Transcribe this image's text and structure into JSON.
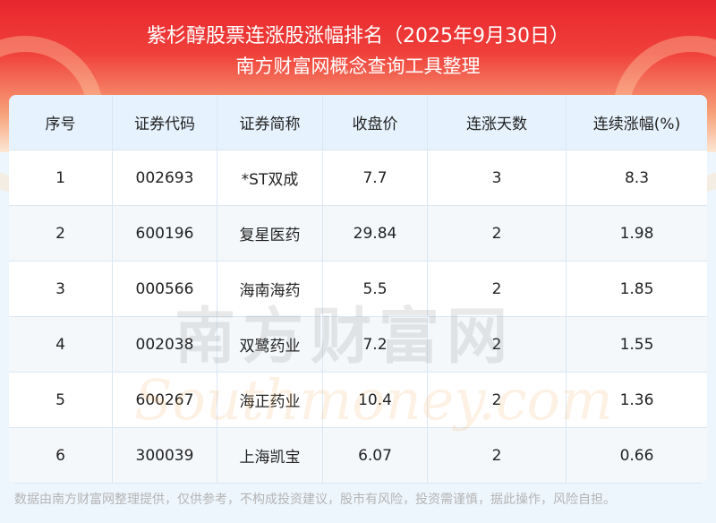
{
  "header": {
    "title": "紫杉醇股票连涨股涨幅排名（2025年9月30日）",
    "subtitle": "南方财富网概念查询工具整理"
  },
  "table": {
    "columns": [
      "序号",
      "证券代码",
      "证券简称",
      "收盘价",
      "连涨天数",
      "连续涨幅(%)"
    ],
    "rows": [
      [
        "1",
        "002693",
        "*ST双成",
        "7.7",
        "3",
        "8.3"
      ],
      [
        "2",
        "600196",
        "复星医药",
        "29.84",
        "2",
        "1.98"
      ],
      [
        "3",
        "000566",
        "海南海药",
        "5.5",
        "2",
        "1.85"
      ],
      [
        "4",
        "002038",
        "双鹭药业",
        "7.2",
        "2",
        "1.55"
      ],
      [
        "5",
        "600267",
        "海正药业",
        "10.4",
        "2",
        "1.36"
      ],
      [
        "6",
        "300039",
        "上海凯宝",
        "6.07",
        "2",
        "0.66"
      ]
    ]
  },
  "watermark": {
    "cn": "南方财富网",
    "en": "Southmoney.com"
  },
  "footer": "数据由南方财富网整理提供，仅供参考，不构成投资建议，股市有风险，投资需谨慎，据此操作，风险自担。"
}
